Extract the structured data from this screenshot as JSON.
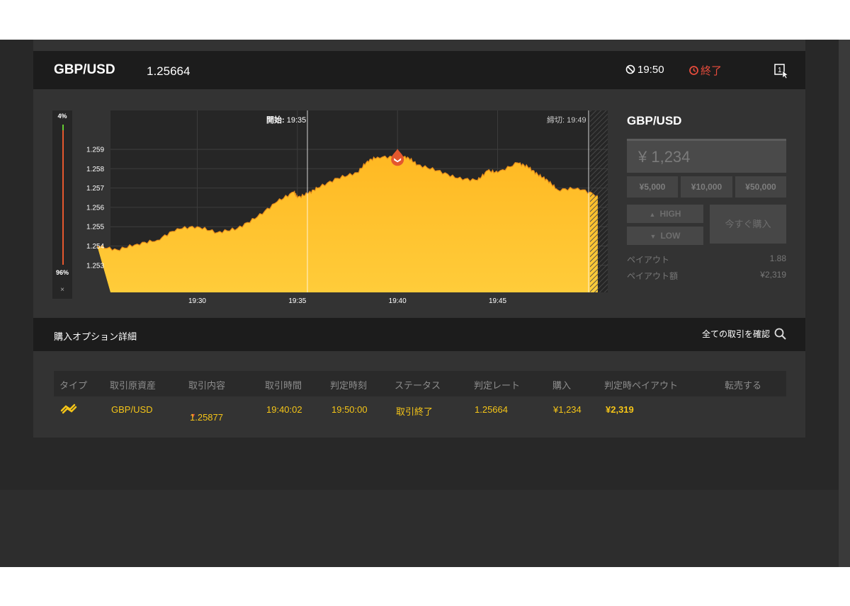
{
  "header": {
    "pair": "GBP/USD",
    "rate": "1.25664",
    "expiry_time": "19:50",
    "status": "終了"
  },
  "chart_data": {
    "type": "area",
    "ylim": [
      1.2523,
      1.2603
    ],
    "y_ticks": [
      "1.259",
      "1.258",
      "1.257",
      "1.256",
      "1.255",
      "1.254",
      "1.253"
    ],
    "x_ticks": [
      "19:30",
      "19:35",
      "19:40",
      "19:45"
    ],
    "start_label": "開始:",
    "start_time": "19:35",
    "end_label": "締切:",
    "end_time": "19:49",
    "x": [
      "19:25:00",
      "19:26:00",
      "19:27:00",
      "19:28:00",
      "19:29:00",
      "19:30:00",
      "19:31:00",
      "19:32:00",
      "19:33:00",
      "19:34:00",
      "19:34:50",
      "19:35:00",
      "19:35:30",
      "19:36:00",
      "19:37:00",
      "19:38:00",
      "19:38:30",
      "19:39:00",
      "19:40:00",
      "19:40:30",
      "19:41:00",
      "19:42:00",
      "19:43:00",
      "19:44:00",
      "19:44:30",
      "19:45:00",
      "19:46:00",
      "19:46:30",
      "19:47:00",
      "19:47:30",
      "19:48:00",
      "19:49:00",
      "19:50:00"
    ],
    "values": [
      1.254,
      1.2538,
      1.2541,
      1.2543,
      1.2549,
      1.255,
      1.2547,
      1.2549,
      1.2555,
      1.2563,
      1.2568,
      1.2565,
      1.2567,
      1.257,
      1.2575,
      1.2578,
      1.2584,
      1.2586,
      1.2586,
      1.2586,
      1.2582,
      1.2579,
      1.2575,
      1.2574,
      1.2579,
      1.2578,
      1.2583,
      1.2581,
      1.2577,
      1.2574,
      1.2569,
      1.257,
      1.2566
    ],
    "purchase_x": "19:40:00",
    "purchase_y": 1.25877
  },
  "gauge": {
    "top_label": "4%",
    "bottom_label": "96%",
    "close_label": "×"
  },
  "trade_panel": {
    "title": "GBP/USD",
    "amount": "¥ 1,234",
    "presets": [
      "¥5,000",
      "¥10,000",
      "¥50,000"
    ],
    "high_label": "HIGH",
    "low_label": "LOW",
    "buy_label": "今すぐ購入",
    "payout_label": "ペイアウト",
    "payout_value": "1.88",
    "payout_amount_label": "ペイアウト額",
    "payout_amount_value": "¥2,319"
  },
  "details": {
    "title": "購入オプション詳細",
    "link": "全ての取引を確認"
  },
  "table": {
    "headers": [
      "タイプ",
      "取引原資産",
      "取引内容",
      "取引時間",
      "判定時刻",
      "ステータス",
      "判定レート",
      "購入",
      "判定時ペイアウト",
      "転売する"
    ],
    "row": {
      "asset": "GBP/USD",
      "content": "1.25877",
      "trade_time": "19:40:02",
      "judge_time": "19:50:00",
      "status": "取引終了",
      "judge_rate": "1.25664",
      "purchase": "¥1,234",
      "payout": "¥2,319"
    }
  },
  "colors": {
    "accent": "#f5c518",
    "danger": "#e74c3c",
    "chart_fill": "#ffc233"
  }
}
